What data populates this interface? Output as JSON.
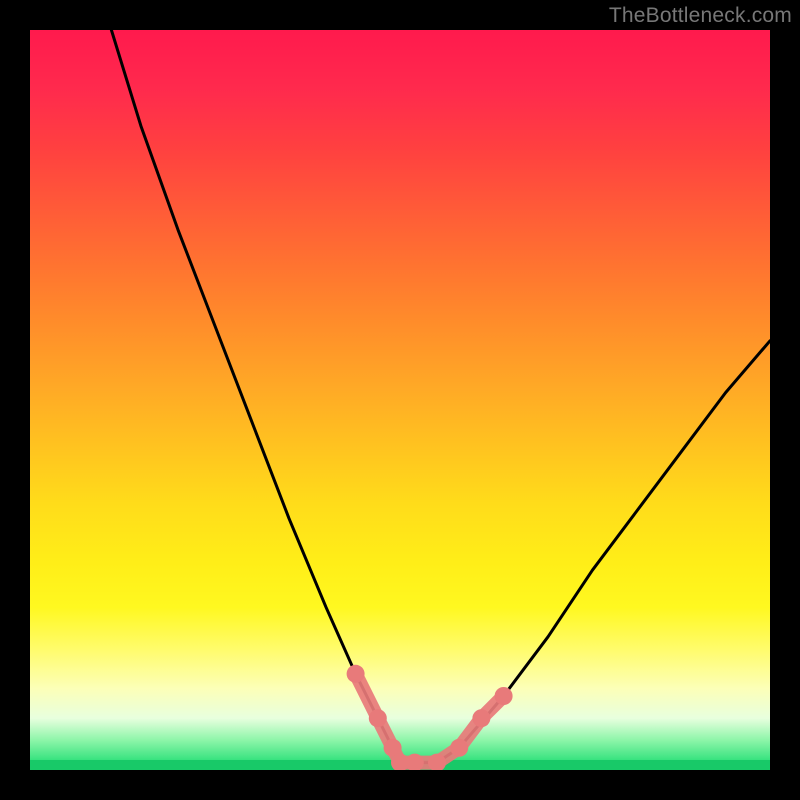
{
  "watermark": "TheBottleneck.com",
  "chart_data": {
    "type": "line",
    "title": "",
    "xlabel": "",
    "ylabel": "",
    "xlim": [
      0,
      100
    ],
    "ylim": [
      0,
      100
    ],
    "series": [
      {
        "name": "bottleneck-curve",
        "x": [
          11,
          15,
          20,
          25,
          30,
          35,
          40,
          44,
          47,
          49,
          50,
          52,
          55,
          58,
          64,
          70,
          76,
          82,
          88,
          94,
          100
        ],
        "values": [
          100,
          87,
          73,
          60,
          47,
          34,
          22,
          13,
          7,
          3,
          1,
          1,
          1,
          3,
          10,
          18,
          27,
          35,
          43,
          51,
          58
        ]
      }
    ],
    "markers": {
      "name": "flat-bottom-highlight",
      "color": "#e87a7a",
      "points": [
        {
          "x": 44,
          "y": 13
        },
        {
          "x": 47,
          "y": 7
        },
        {
          "x": 49,
          "y": 3
        },
        {
          "x": 50,
          "y": 1
        },
        {
          "x": 52,
          "y": 1
        },
        {
          "x": 55,
          "y": 1
        },
        {
          "x": 58,
          "y": 3
        },
        {
          "x": 61,
          "y": 7
        },
        {
          "x": 64,
          "y": 10
        }
      ]
    },
    "background_gradient": {
      "top": "#ff1a4d",
      "mid": "#ffdc1a",
      "bottom": "#18c968"
    }
  }
}
